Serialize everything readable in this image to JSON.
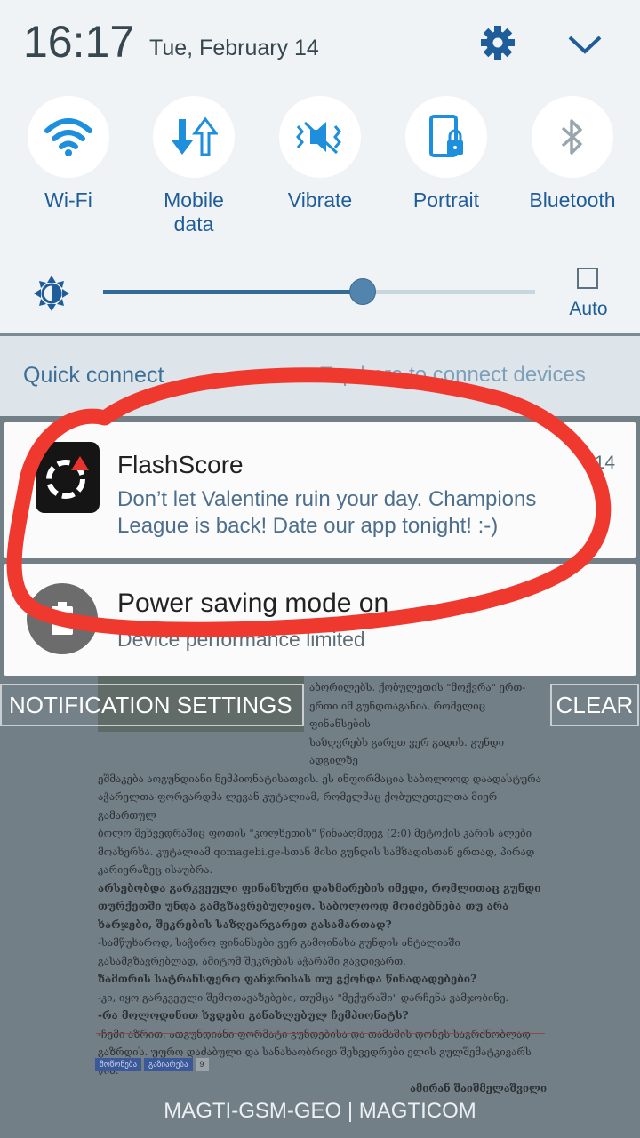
{
  "status": {
    "time": "16:17",
    "date": "Tue, February 14"
  },
  "toggles": [
    {
      "label": "Wi-Fi",
      "icon": "wifi-icon",
      "active": true
    },
    {
      "label": "Mobile data",
      "icon": "mobile-data-icon",
      "active": true
    },
    {
      "label": "Vibrate",
      "icon": "vibrate-icon",
      "active": true
    },
    {
      "label": "Portrait",
      "icon": "portrait-lock-icon",
      "active": true
    },
    {
      "label": "Bluetooth",
      "icon": "bluetooth-icon",
      "active": false
    }
  ],
  "brightness": {
    "level": 0.6,
    "auto_label": "Auto",
    "auto_checked": false
  },
  "quick_connect": {
    "title": "Quick connect",
    "hint": "Tap here to connect devices"
  },
  "notifications": [
    {
      "app": "FlashScore",
      "message": "Don’t let Valentine ruin your day. Champions League is back! Date our app tonight! :-)",
      "time": "14"
    },
    {
      "title": "Power saving mode on",
      "subtitle": "Device performance limited"
    }
  ],
  "buttons": {
    "settings": "NOTIFICATION SETTINGS",
    "clear": "CLEAR"
  },
  "carrier": "MAGTI-GSM-GEO | MAGTICOM",
  "background_article": {
    "top_lines": [
      "აბორილებს. ქობულეთის \"მოქვრა\" ერთ-",
      "ერთი იმ გუნდთაგანია, რომელიც ფინანსების",
      "საზღვრებს გარეთ ვერ გადის. გუნდი ადგილზე"
    ],
    "lines": [
      "ეშმაკება აოგუნდიანი ნემპიონატისათვის. ეს ინფორმაცია საბოლოოდ დაადასტურა",
      "აჭარელთა ფორვარდმა ლევან კუტალიამ, რომელმაც ქობულეთელთა მიერ გამართულ",
      "ბოლო შეხვედრაშიც ფოთის \"კოლხეთის\" წინააღმდეგ (2:0) მეტოქის კარის ალები",
      "მოახერხა. კუტალიამ qomagebi.ge-სთან მისი გუნდის სამზადისთან ერთად, პირად",
      "კარიერაზეც ისაუბრა."
    ],
    "bold_q1": "არსებობდა გარკვეული ფინანსური დახმარების იმედი, რომლითაც გუნდი თურქეთში უნდა გამგზავრებულიყო. საბოლოოდ მოიძებნება თუ არა ხარჯები, შეკრების საზღვარგარეთ გასამართად?",
    "a1": "-სამწუხაროდ, საჭირო ფინანსები ვერ გამოინახა გუნდის ანტალიაში გასამგზავრებლად, ამიტომ შეკრებას აჭარაში გავდივართ.",
    "bold_q2": "ზამთრის სატრანსფერო ფანჯრისას თუ გქონდა წინადადებები?",
    "a2": "-კი, იყო გარკვეული შემოთავაზებები, თუმცა \"მექურაში\" დარჩენა ვამჯობინე.",
    "bold_q3": "-რა მოლოდინით ხვდები განახლებულ ჩემპიონატს?",
    "a3": "-ჩემი აზრით, ათგუნდიანი ფორმატი გუნდებისა და თამაშის დონეს საგრძნობლად გაზრდის. უფრო დაძაბული და სანახაობრივი შეხვედრები ელის გულშემატკივარს წინ.",
    "signature": "ამირან შაიშმელაშვილი",
    "share": [
      "მოწონება",
      "გაზიარება",
      "9"
    ]
  },
  "colors": {
    "accent": "#1f5d9a",
    "annotation": "#f0392e",
    "panel": "#f0f3f5"
  }
}
